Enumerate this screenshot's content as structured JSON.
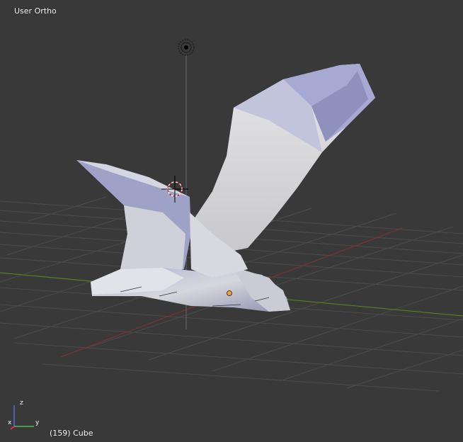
{
  "viewport": {
    "view_label": "User Ortho",
    "object_info": "(159) Cube",
    "background_color": "#393939",
    "grid_color": "#4b4b4b",
    "x_axis_color": "#8a2f2f",
    "y_axis_color": "#5b8a1e",
    "z_axis_color": "#6a6a6a",
    "mesh_color": "#c9ccd6"
  },
  "axis_gizmo": {
    "x_label": "x",
    "y_label": "y",
    "z_label": "z",
    "x_color": "#e03030",
    "y_color": "#4ec04e",
    "z_color": "#4a6ee8"
  },
  "icons": {
    "camera": "camera-icon",
    "cursor": "3d-cursor-icon",
    "origin": "object-origin-icon"
  }
}
